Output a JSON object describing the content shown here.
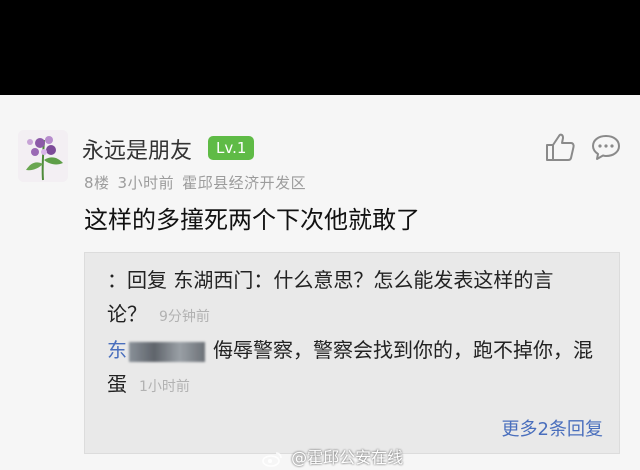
{
  "post": {
    "username": "永远是朋友",
    "level": "Lv.1",
    "floor": "8楼",
    "time": "3小时前",
    "location": "霍邱县经济开发区",
    "text": "这样的多撞死两个下次他就敢了"
  },
  "replies": {
    "first": {
      "text": "：回复 东湖西门：什么意思？怎么能发表这样的言论？",
      "time": "9分钟前"
    },
    "second": {
      "name_visible": "东",
      "text": "侮辱警察，警察会找到你的，跑不掉你，混蛋",
      "time": "1小时前"
    },
    "more_label": "更多2条回复"
  },
  "watermark": {
    "text": "@霍邱公安在线"
  },
  "icons": {
    "like": "thumbs-up-icon",
    "comment": "comment-bubble-icon"
  },
  "colors": {
    "level_badge": "#5fbb46",
    "link": "#4a6fbd"
  }
}
